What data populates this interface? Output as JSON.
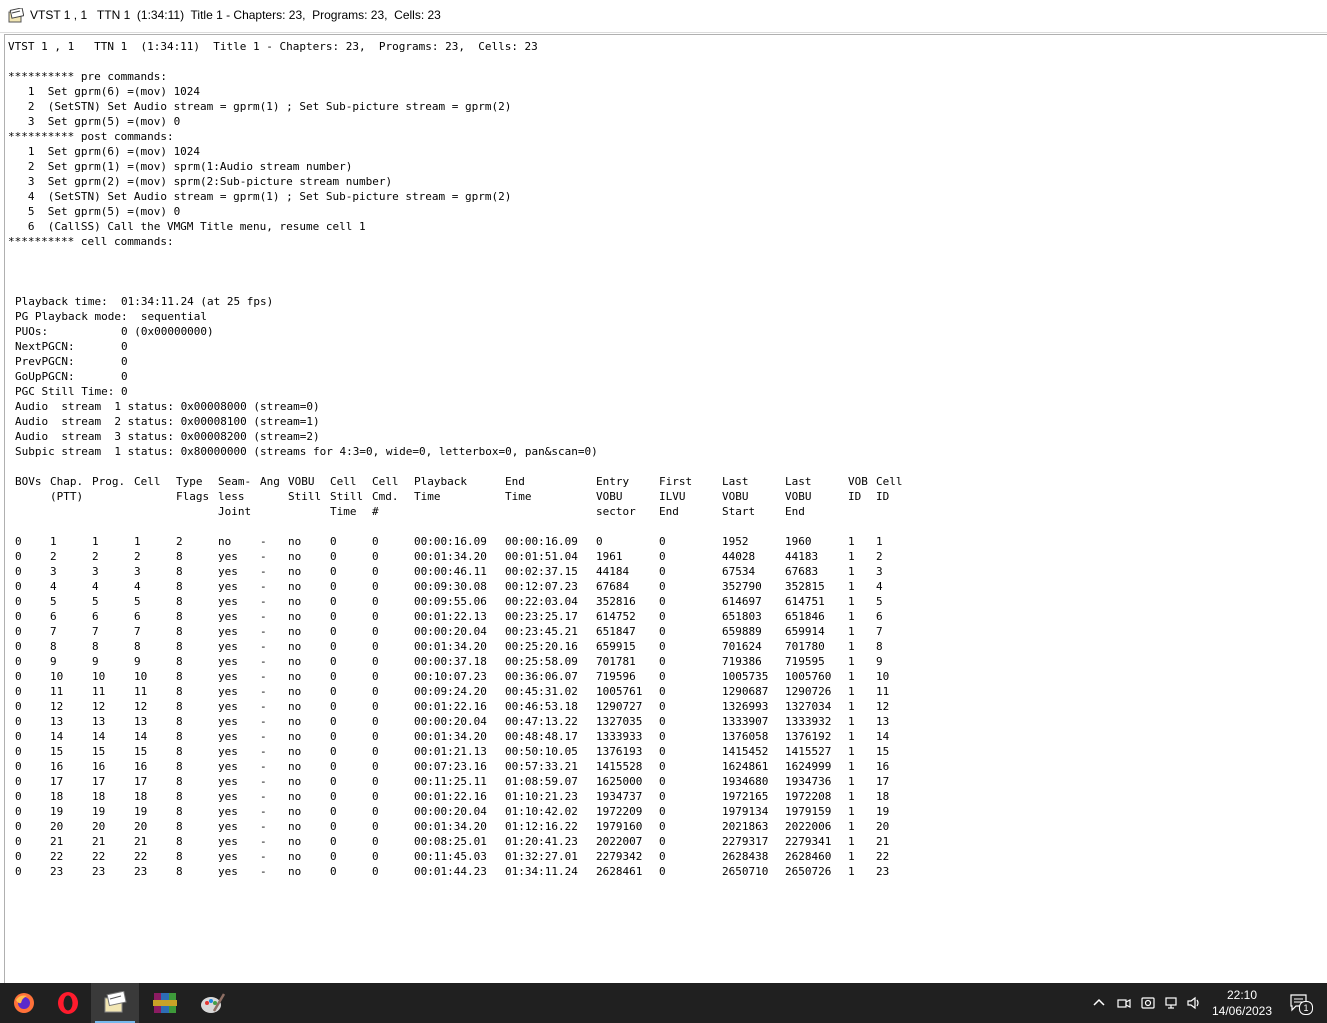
{
  "window": {
    "title": "VTST 1 , 1   TTN 1  (1:34:11)  Title 1 - Chapters: 23,  Programs: 23,  Cells: 23"
  },
  "content": {
    "header_line": "VTST 1 , 1   TTN 1  (1:34:11)  Title 1 - Chapters: 23,  Programs: 23,  Cells: 23",
    "commands_text": "********** pre commands:\n   1  Set gprm(6) =(mov) 1024\n   2  (SetSTN) Set Audio stream = gprm(1) ; Set Sub-picture stream = gprm(2)\n   3  Set gprm(5) =(mov) 0\n********** post commands:\n   1  Set gprm(6) =(mov) 1024\n   2  Set gprm(1) =(mov) sprm(1:Audio stream number)\n   3  Set gprm(2) =(mov) sprm(2:Sub-picture stream number)\n   4  (SetSTN) Set Audio stream = gprm(1) ; Set Sub-picture stream = gprm(2)\n   5  Set gprm(5) =(mov) 0\n   6  (CallSS) Call the VMGM Title menu, resume cell 1\n********** cell commands:",
    "info_text": "Playback time:  01:34:11.24 (at 25 fps)\nPG Playback mode:  sequential\nPUOs:           0 (0x00000000)\nNextPGCN:       0\nPrevPGCN:       0\nGoUpPGCN:       0\nPGC Still Time: 0\nAudio  stream  1 status: 0x00008000 (stream=0)\nAudio  stream  2 status: 0x00008100 (stream=1)\nAudio  stream  3 status: 0x00008200 (stream=2)\nSubpic stream  1 status: 0x80000000 (streams for 4:3=0, wide=0, letterbox=0, pan&scan=0)"
  },
  "table": {
    "headers": [
      "BOVs",
      "Chap.\n(PTT)",
      "Prog.",
      "Cell",
      "Type\nFlags",
      "Seam-\nless\nJoint",
      "Ang",
      "VOBU\nStill",
      "Cell\nStill\nTime",
      "Cell\nCmd.\n#",
      "Playback\nTime",
      "End\nTime",
      "Entry\nVOBU\nsector",
      "First\nILVU\nEnd",
      "Last\nVOBU\nStart",
      "Last\nVOBU\nEnd",
      "VOB\nID",
      "Cell\nID"
    ],
    "rows": [
      [
        "0",
        "1",
        "1",
        "1",
        "2",
        "no",
        "-",
        "no",
        "0",
        "0",
        "00:00:16.09",
        "00:00:16.09",
        "0",
        "0",
        "1952",
        "1960",
        "1",
        "1"
      ],
      [
        "0",
        "2",
        "2",
        "2",
        "8",
        "yes",
        "-",
        "no",
        "0",
        "0",
        "00:01:34.20",
        "00:01:51.04",
        "1961",
        "0",
        "44028",
        "44183",
        "1",
        "2"
      ],
      [
        "0",
        "3",
        "3",
        "3",
        "8",
        "yes",
        "-",
        "no",
        "0",
        "0",
        "00:00:46.11",
        "00:02:37.15",
        "44184",
        "0",
        "67534",
        "67683",
        "1",
        "3"
      ],
      [
        "0",
        "4",
        "4",
        "4",
        "8",
        "yes",
        "-",
        "no",
        "0",
        "0",
        "00:09:30.08",
        "00:12:07.23",
        "67684",
        "0",
        "352790",
        "352815",
        "1",
        "4"
      ],
      [
        "0",
        "5",
        "5",
        "5",
        "8",
        "yes",
        "-",
        "no",
        "0",
        "0",
        "00:09:55.06",
        "00:22:03.04",
        "352816",
        "0",
        "614697",
        "614751",
        "1",
        "5"
      ],
      [
        "0",
        "6",
        "6",
        "6",
        "8",
        "yes",
        "-",
        "no",
        "0",
        "0",
        "00:01:22.13",
        "00:23:25.17",
        "614752",
        "0",
        "651803",
        "651846",
        "1",
        "6"
      ],
      [
        "0",
        "7",
        "7",
        "7",
        "8",
        "yes",
        "-",
        "no",
        "0",
        "0",
        "00:00:20.04",
        "00:23:45.21",
        "651847",
        "0",
        "659889",
        "659914",
        "1",
        "7"
      ],
      [
        "0",
        "8",
        "8",
        "8",
        "8",
        "yes",
        "-",
        "no",
        "0",
        "0",
        "00:01:34.20",
        "00:25:20.16",
        "659915",
        "0",
        "701624",
        "701780",
        "1",
        "8"
      ],
      [
        "0",
        "9",
        "9",
        "9",
        "8",
        "yes",
        "-",
        "no",
        "0",
        "0",
        "00:00:37.18",
        "00:25:58.09",
        "701781",
        "0",
        "719386",
        "719595",
        "1",
        "9"
      ],
      [
        "0",
        "10",
        "10",
        "10",
        "8",
        "yes",
        "-",
        "no",
        "0",
        "0",
        "00:10:07.23",
        "00:36:06.07",
        "719596",
        "0",
        "1005735",
        "1005760",
        "1",
        "10"
      ],
      [
        "0",
        "11",
        "11",
        "11",
        "8",
        "yes",
        "-",
        "no",
        "0",
        "0",
        "00:09:24.20",
        "00:45:31.02",
        "1005761",
        "0",
        "1290687",
        "1290726",
        "1",
        "11"
      ],
      [
        "0",
        "12",
        "12",
        "12",
        "8",
        "yes",
        "-",
        "no",
        "0",
        "0",
        "00:01:22.16",
        "00:46:53.18",
        "1290727",
        "0",
        "1326993",
        "1327034",
        "1",
        "12"
      ],
      [
        "0",
        "13",
        "13",
        "13",
        "8",
        "yes",
        "-",
        "no",
        "0",
        "0",
        "00:00:20.04",
        "00:47:13.22",
        "1327035",
        "0",
        "1333907",
        "1333932",
        "1",
        "13"
      ],
      [
        "0",
        "14",
        "14",
        "14",
        "8",
        "yes",
        "-",
        "no",
        "0",
        "0",
        "00:01:34.20",
        "00:48:48.17",
        "1333933",
        "0",
        "1376058",
        "1376192",
        "1",
        "14"
      ],
      [
        "0",
        "15",
        "15",
        "15",
        "8",
        "yes",
        "-",
        "no",
        "0",
        "0",
        "00:01:21.13",
        "00:50:10.05",
        "1376193",
        "0",
        "1415452",
        "1415527",
        "1",
        "15"
      ],
      [
        "0",
        "16",
        "16",
        "16",
        "8",
        "yes",
        "-",
        "no",
        "0",
        "0",
        "00:07:23.16",
        "00:57:33.21",
        "1415528",
        "0",
        "1624861",
        "1624999",
        "1",
        "16"
      ],
      [
        "0",
        "17",
        "17",
        "17",
        "8",
        "yes",
        "-",
        "no",
        "0",
        "0",
        "00:11:25.11",
        "01:08:59.07",
        "1625000",
        "0",
        "1934680",
        "1934736",
        "1",
        "17"
      ],
      [
        "0",
        "18",
        "18",
        "18",
        "8",
        "yes",
        "-",
        "no",
        "0",
        "0",
        "00:01:22.16",
        "01:10:21.23",
        "1934737",
        "0",
        "1972165",
        "1972208",
        "1",
        "18"
      ],
      [
        "0",
        "19",
        "19",
        "19",
        "8",
        "yes",
        "-",
        "no",
        "0",
        "0",
        "00:00:20.04",
        "01:10:42.02",
        "1972209",
        "0",
        "1979134",
        "1979159",
        "1",
        "19"
      ],
      [
        "0",
        "20",
        "20",
        "20",
        "8",
        "yes",
        "-",
        "no",
        "0",
        "0",
        "00:01:34.20",
        "01:12:16.22",
        "1979160",
        "0",
        "2021863",
        "2022006",
        "1",
        "20"
      ],
      [
        "0",
        "21",
        "21",
        "21",
        "8",
        "yes",
        "-",
        "no",
        "0",
        "0",
        "00:08:25.01",
        "01:20:41.23",
        "2022007",
        "0",
        "2279317",
        "2279341",
        "1",
        "21"
      ],
      [
        "0",
        "22",
        "22",
        "22",
        "8",
        "yes",
        "-",
        "no",
        "0",
        "0",
        "00:11:45.03",
        "01:32:27.01",
        "2279342",
        "0",
        "2628438",
        "2628460",
        "1",
        "22"
      ],
      [
        "0",
        "23",
        "23",
        "23",
        "8",
        "yes",
        "-",
        "no",
        "0",
        "0",
        "00:01:44.23",
        "01:34:11.24",
        "2628461",
        "0",
        "2650710",
        "2650726",
        "1",
        "23"
      ]
    ]
  },
  "taskbar": {
    "apps": [
      {
        "name": "firefox-icon",
        "active": false
      },
      {
        "name": "opera-icon",
        "active": false
      },
      {
        "name": "ifoedit-icon",
        "active": true
      },
      {
        "name": "winrar-icon",
        "active": false
      },
      {
        "name": "paint-icon",
        "active": false
      }
    ],
    "time": "22:10",
    "date": "14/06/2023",
    "notification_count": "1"
  },
  "colors": {
    "taskbar_bg": "#202020",
    "active_app_underline": "#76b9ed",
    "firefox_orange": "#ff7139",
    "opera_red": "#ff1b2d"
  }
}
